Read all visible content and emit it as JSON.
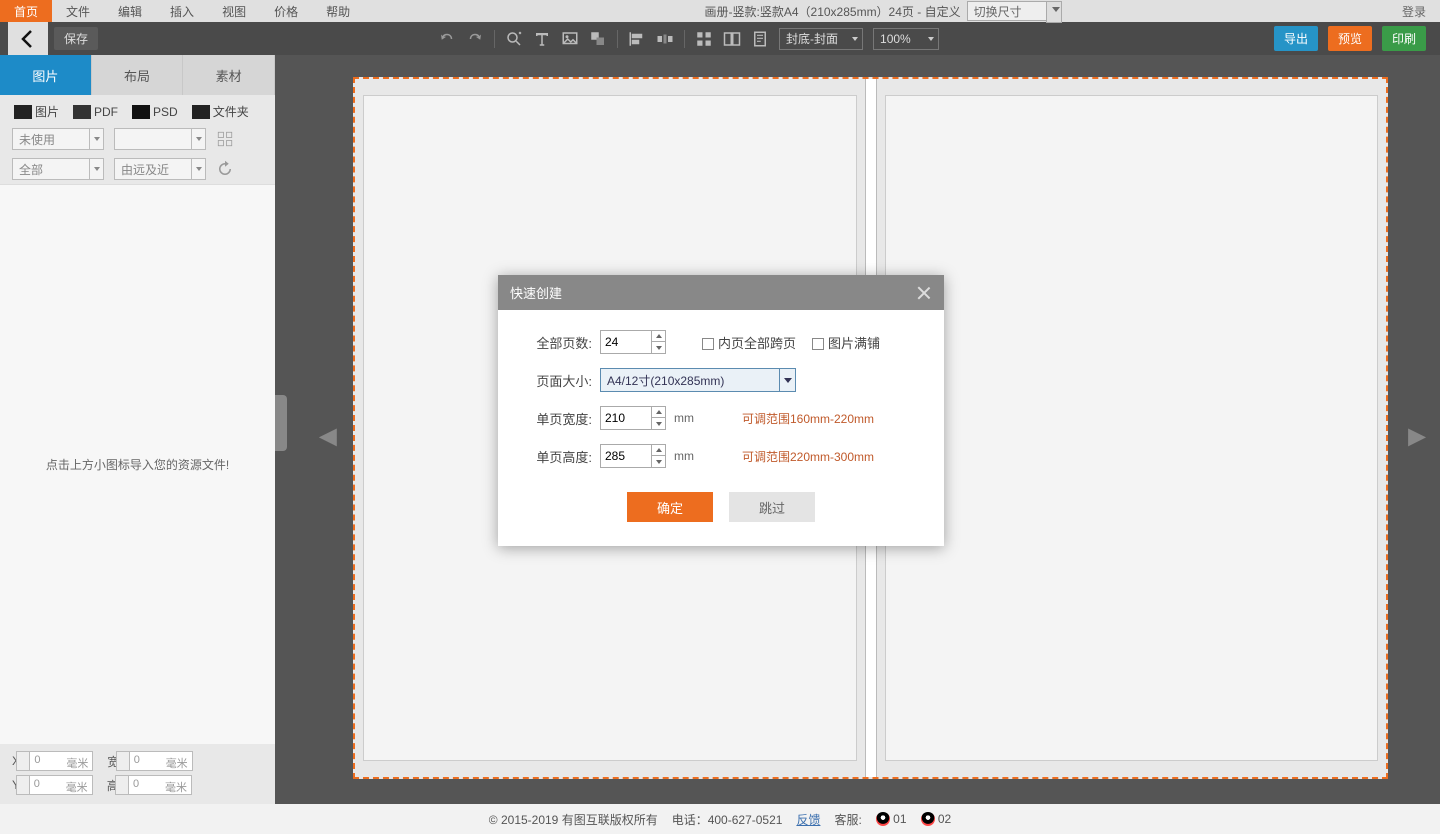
{
  "menubar": {
    "items": [
      "首页",
      "文件",
      "编辑",
      "插入",
      "视图",
      "价格",
      "帮助"
    ],
    "doctitle": "画册-竖款:竖款A4（210x285mm）24页 - 自定义",
    "size_select": "切换尺寸",
    "login": "登录"
  },
  "toolbar": {
    "save": "保存",
    "page_select": "封底-封面",
    "zoom": "100%",
    "export": "导出",
    "preview": "预览",
    "print": "印刷"
  },
  "sidetabs": [
    "图片",
    "布局",
    "素材"
  ],
  "sidepanel": {
    "imports": [
      "图片",
      "PDF",
      "PSD",
      "文件夹"
    ],
    "filter1": "未使用",
    "filter2": "",
    "filter3": "全部",
    "filter4": "由远及近",
    "placeholder": "点击上方小图标导入您的资源文件!",
    "coord_x_label": "X:",
    "coord_x": "0",
    "coord_x_unit": "毫米",
    "coord_y_label": "Y:",
    "coord_y": "0",
    "coord_y_unit": "毫米",
    "coord_w_label": "宽:",
    "coord_w": "0",
    "coord_w_unit": "毫米",
    "coord_h_label": "高:",
    "coord_h": "0",
    "coord_h_unit": "毫米"
  },
  "modal": {
    "title": "快速创建",
    "pages_label": "全部页数:",
    "pages_value": "24",
    "chk1": "内页全部跨页",
    "chk2": "图片满铺",
    "size_label": "页面大小:",
    "size_value": "A4/12寸(210x285mm)",
    "width_label": "单页宽度:",
    "width_value": "210",
    "width_hint": "可调范围160mm-220mm",
    "height_label": "单页高度:",
    "height_value": "285",
    "height_hint": "可调范围220mm-300mm",
    "unit": "mm",
    "ok": "确定",
    "skip": "跳过"
  },
  "footer": {
    "copyright": "© 2015-2019 有图互联版权所有",
    "phone": "电话：400-627-0521",
    "feedback": "反馈",
    "service_label": "客服:",
    "qq1": "01",
    "qq2": "02"
  }
}
